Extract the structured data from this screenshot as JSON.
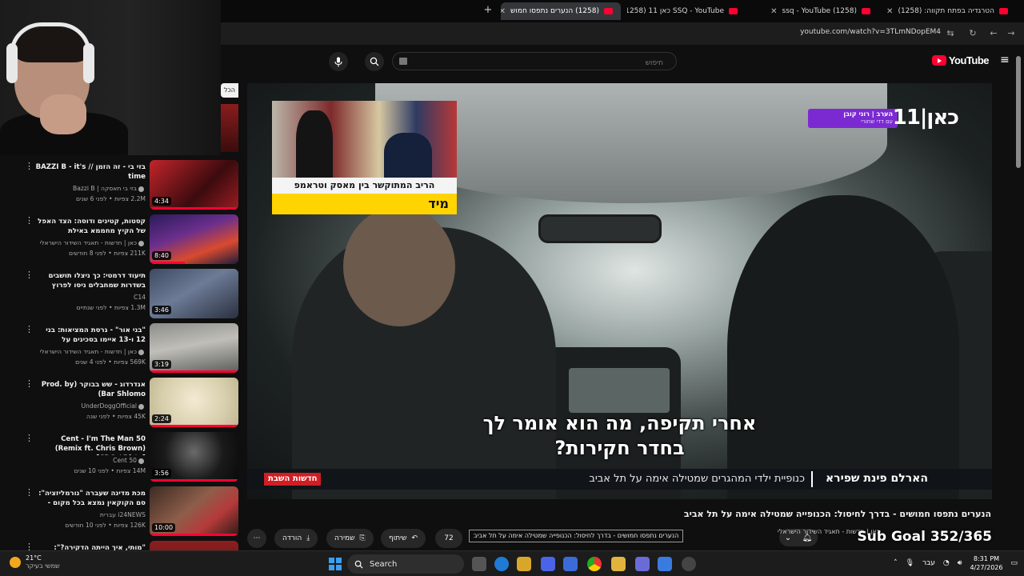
{
  "browser": {
    "tabs": [
      {
        "label": "הטרגדיה בפתח תקווה: (1258)",
        "active": false
      },
      {
        "label": "(1258) ssq - YouTube",
        "active": false
      },
      {
        "label": "SSQ - YouTube כאן 11 (1258)",
        "active": false
      },
      {
        "label": "(1258) הנערים נתפסו חמוש",
        "active": true
      }
    ],
    "new_tab_symbol": "+",
    "close_symbol": "✕",
    "url": "youtube.com/watch?v=3TLmNDopEM4"
  },
  "youtube": {
    "logo_text": "YouTube",
    "search_placeholder": "חיפוש",
    "peek_tag": "הכל",
    "peek_thumb_text": "ש מ"
  },
  "recommendations": [
    {
      "title": "בזי בי - זה הזמן // BAZZI B - it's time",
      "channel": "בזי בי תאסקה | Bazzi B",
      "meta": "2.2M צפיות • לפני 6 שנים",
      "duration": "4:34",
      "progress": 1.0,
      "verified": true
    },
    {
      "title": "קסטות, קטינים ודוסה: הצד האפל של הקיץ מחממא באילת",
      "channel": "כאן | חדשות - תאגיד השידור הישראלי",
      "meta": "211K צפיות • לפני 8 חודשים",
      "duration": "8:40",
      "progress": 0.4,
      "verified": true
    },
    {
      "title": "תיעוד דרמטי: כך ניצלו תושבים בשדרות שמחבלים ניסו לפרוץ",
      "channel": "C14",
      "meta": "1.3M צפיות • לפני שנתיים",
      "duration": "3:46",
      "progress": 0.0,
      "verified": false
    },
    {
      "title": "\"בני אור\" - גרסת המציאות: בני 12 ו-13 איימו בסכינים על סטודנטים ...",
      "channel": "כאן | חדשות - תאגיד השידור הישראלי",
      "meta": "569K צפיות • לפני 4 שנים",
      "duration": "3:19",
      "progress": 1.0,
      "verified": true
    },
    {
      "title": "אנדרדוג - שש בבוקר (Prod. by Bar Shlomo)",
      "channel": "UnderDoggOfficial",
      "meta": "45K צפיות • לפני שנה",
      "duration": "2:24",
      "progress": 1.0,
      "verified": true
    },
    {
      "title": "50 Cent - I'm The Man (Remix ft. Chris Brown) [CDQ / Dirty]",
      "channel": "50 Cent",
      "meta": "14M צפיות • לפני 10 שנים",
      "duration": "3:56",
      "progress": 1.0,
      "verified": true
    },
    {
      "title": "מכת מדינה שעברה \"נורמליזציה\": סם הקוקאין נמצא בכל מקום - האם המ...",
      "channel": "i24NEWS עברית",
      "meta": "126K צפיות • לפני 10 חודשים",
      "duration": "10:00",
      "progress": 1.0,
      "verified": false
    },
    {
      "title": "\"מותי, איך הייתה הדקירה?\": משפחות",
      "channel": "",
      "meta": "",
      "duration": "",
      "progress": 1.0,
      "verified": false
    }
  ],
  "player": {
    "inset_caption": "הריב המתוקשר בין מאסק וטראמפ",
    "inset_tag": "מיד",
    "channel_logo": "כאן|11",
    "show_tag_line1": "הערב | רוני קובן",
    "show_tag_line2": "עם דדי שחורי",
    "subtitle_line1": "אחרי תקיפה, מה הוא אומר לך",
    "subtitle_line2": "בחדר חקירות?",
    "lower_badge": "חדשות השבת",
    "lower_topic": "הארלם פינת שפירא",
    "lower_subtopic": "כנופיית ילדי המהגרים שמטילה אימה על תל אביב"
  },
  "video": {
    "title": "הנערים נתפסו חמושים - בדרך לחיסול: הכנופייה שמטילה אימה על תל אביב",
    "tooltip": "הנערים נתפסו חמושים - בדרך לחיסול: הכנופייה שמטילה אימה על תל אביב",
    "channel_line": "כאן | חדשות - תאגיד השידור הישראלי",
    "like_count": "72",
    "share_label": "שיתוף",
    "save_label": "שמירה",
    "download_label": "הורדה",
    "more_symbol": "⋯",
    "sub_goal": "Sub Goal 352/365"
  },
  "taskbar": {
    "temp": "21°C",
    "weather": "שמשי בעיקר",
    "search_label": "Search",
    "lang": "עבר",
    "time": "8:31 PM",
    "date": "4/27/2026"
  },
  "colors": {
    "yt_red": "#ff0033",
    "kan_purple": "#7b2ad1",
    "ticker_yellow": "#ffd400",
    "news_red": "#d11d24"
  }
}
